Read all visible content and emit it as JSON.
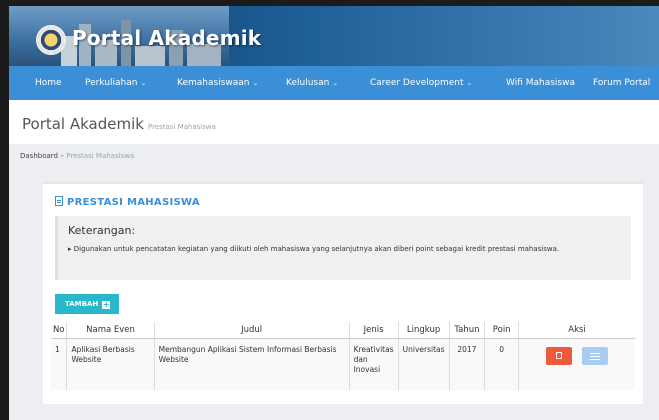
{
  "header": {
    "brand": "Portal Akademik"
  },
  "nav": {
    "items": [
      {
        "label": "Home",
        "caret": false
      },
      {
        "label": "Perkuliahan",
        "caret": true
      },
      {
        "label": "Kemahasiswaan",
        "caret": true
      },
      {
        "label": "Kelulusan",
        "caret": true
      },
      {
        "label": "Career Development",
        "caret": true
      },
      {
        "label": "Wifi Mahasiswa",
        "caret": false
      },
      {
        "label": "Forum Portal",
        "caret": false
      }
    ]
  },
  "page": {
    "title": "Portal Akademik",
    "subtitle": "Prestasi Mahasiswa"
  },
  "breadcrumb": {
    "root": "Dashboard",
    "separator": "»",
    "current": "Prestasi Mahasiswa"
  },
  "panel": {
    "title": "PRESTASI MAHASISWA",
    "note_title": "Keterangan:",
    "note_text": "▸ Digunakan untuk pencatatan kegiatan yang diikuti oleh mahasiswa yang selanjutnya akan diberi point sebagai kredit prestasi mahasiswa.",
    "add_button": "TAMBAH"
  },
  "table": {
    "headers": {
      "no": "No",
      "event": "Nama Even",
      "title": "Judul",
      "type": "Jenis",
      "scope": "Lingkup",
      "year": "Tahun",
      "points": "Poin",
      "action": "Aksi"
    },
    "rows": [
      {
        "no": "1",
        "event": "Aplikasi Berbasis Website",
        "title": "Membangun Aplikasi Sistem Informasi Berbasis Website",
        "type": "Kreativitas dan Inovasi",
        "scope": "Universitas",
        "year": "2017",
        "points": "0"
      }
    ]
  },
  "colors": {
    "nav": "#3a8fd6",
    "accent": "#3a8fd6",
    "add_button": "#2ab7c9",
    "edit_button": "#ef5a3c",
    "detail_button": "#a9cdf0"
  },
  "icons": {
    "logo": "university-seal-icon",
    "panel_title": "document-icon",
    "add": "plus-icon",
    "edit": "edit-icon",
    "detail": "list-icon"
  }
}
